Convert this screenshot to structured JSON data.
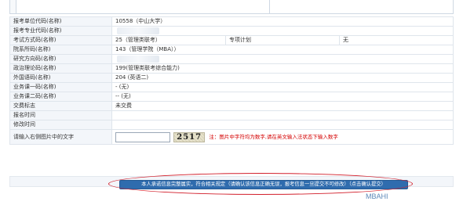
{
  "rows": [
    {
      "label": "报考单位代码(名称)",
      "value": "10558（中山大学）"
    },
    {
      "label": "报考专业代码(名称)",
      "value": ""
    },
    {
      "label": "考试方式码(名称)",
      "value": "25（管理类联考）",
      "extra_label": "专项计划",
      "extra_value": "无"
    },
    {
      "label": "院系所码(名称)",
      "value": "143（管理学院（MBA））"
    },
    {
      "label": "研究方向码(名称)",
      "value": ""
    },
    {
      "label": "政治理论码(名称)",
      "value": "199(管理类联考综合能力)"
    },
    {
      "label": "外国语码(名称)",
      "value": "204 (英语二)"
    },
    {
      "label": "业务课一码(名称)",
      "value": "- (无)"
    },
    {
      "label": "业务课二码(名称)",
      "value": "-- (无)"
    },
    {
      "label": "交费标志",
      "value": "未交费"
    },
    {
      "label": "报名时间",
      "value": ""
    },
    {
      "label": "修改时间",
      "value": ""
    }
  ],
  "captcha": {
    "label": "请输入右侧图片中的文字",
    "input_value": "",
    "image_text": "2517",
    "note": "注：图片中字符均为数字,请在英文输入法状态下输入数字"
  },
  "submit_label": "本人承诺信息完整属实，符合相关规定（请确认该信息正确无误，报考信息一旦提交不可修改）（点击确认提交）",
  "watermark": "MBAHI",
  "colors": {
    "accent": "#2f6cae",
    "highlight": "#d21f2b",
    "note": "#d40000"
  }
}
